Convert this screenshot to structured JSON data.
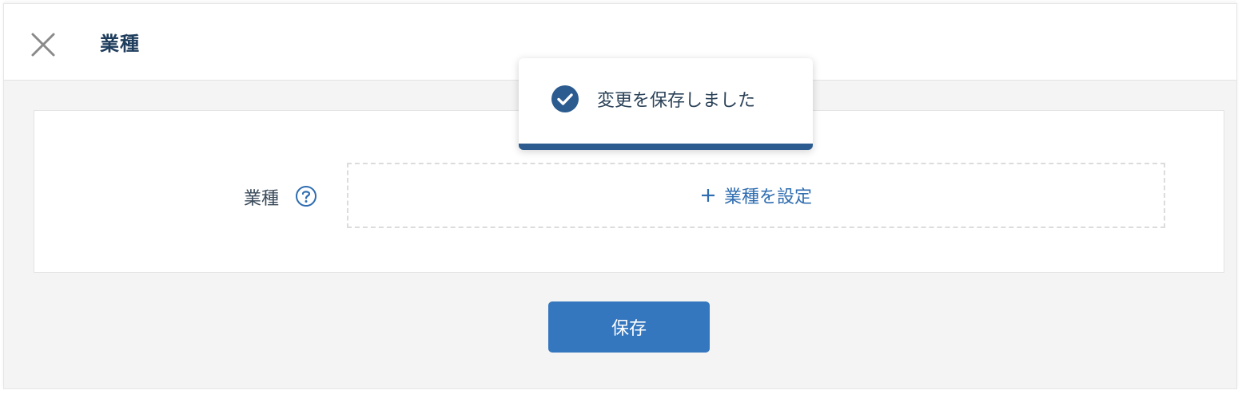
{
  "header": {
    "title": "業種"
  },
  "form": {
    "field_label": "業種",
    "add_label": "業種を設定"
  },
  "footer": {
    "save_label": "保存"
  },
  "toast": {
    "message": "変更を保存しました"
  },
  "icons": {
    "close": "close-icon",
    "help": "help-icon",
    "plus": "plus-icon",
    "check": "check-circle-icon"
  },
  "colors": {
    "primary": "#3477bf",
    "link": "#2f6db0",
    "title": "#1f3d5c",
    "toast_bar": "#2b5b8f",
    "background": "#f4f4f4"
  }
}
